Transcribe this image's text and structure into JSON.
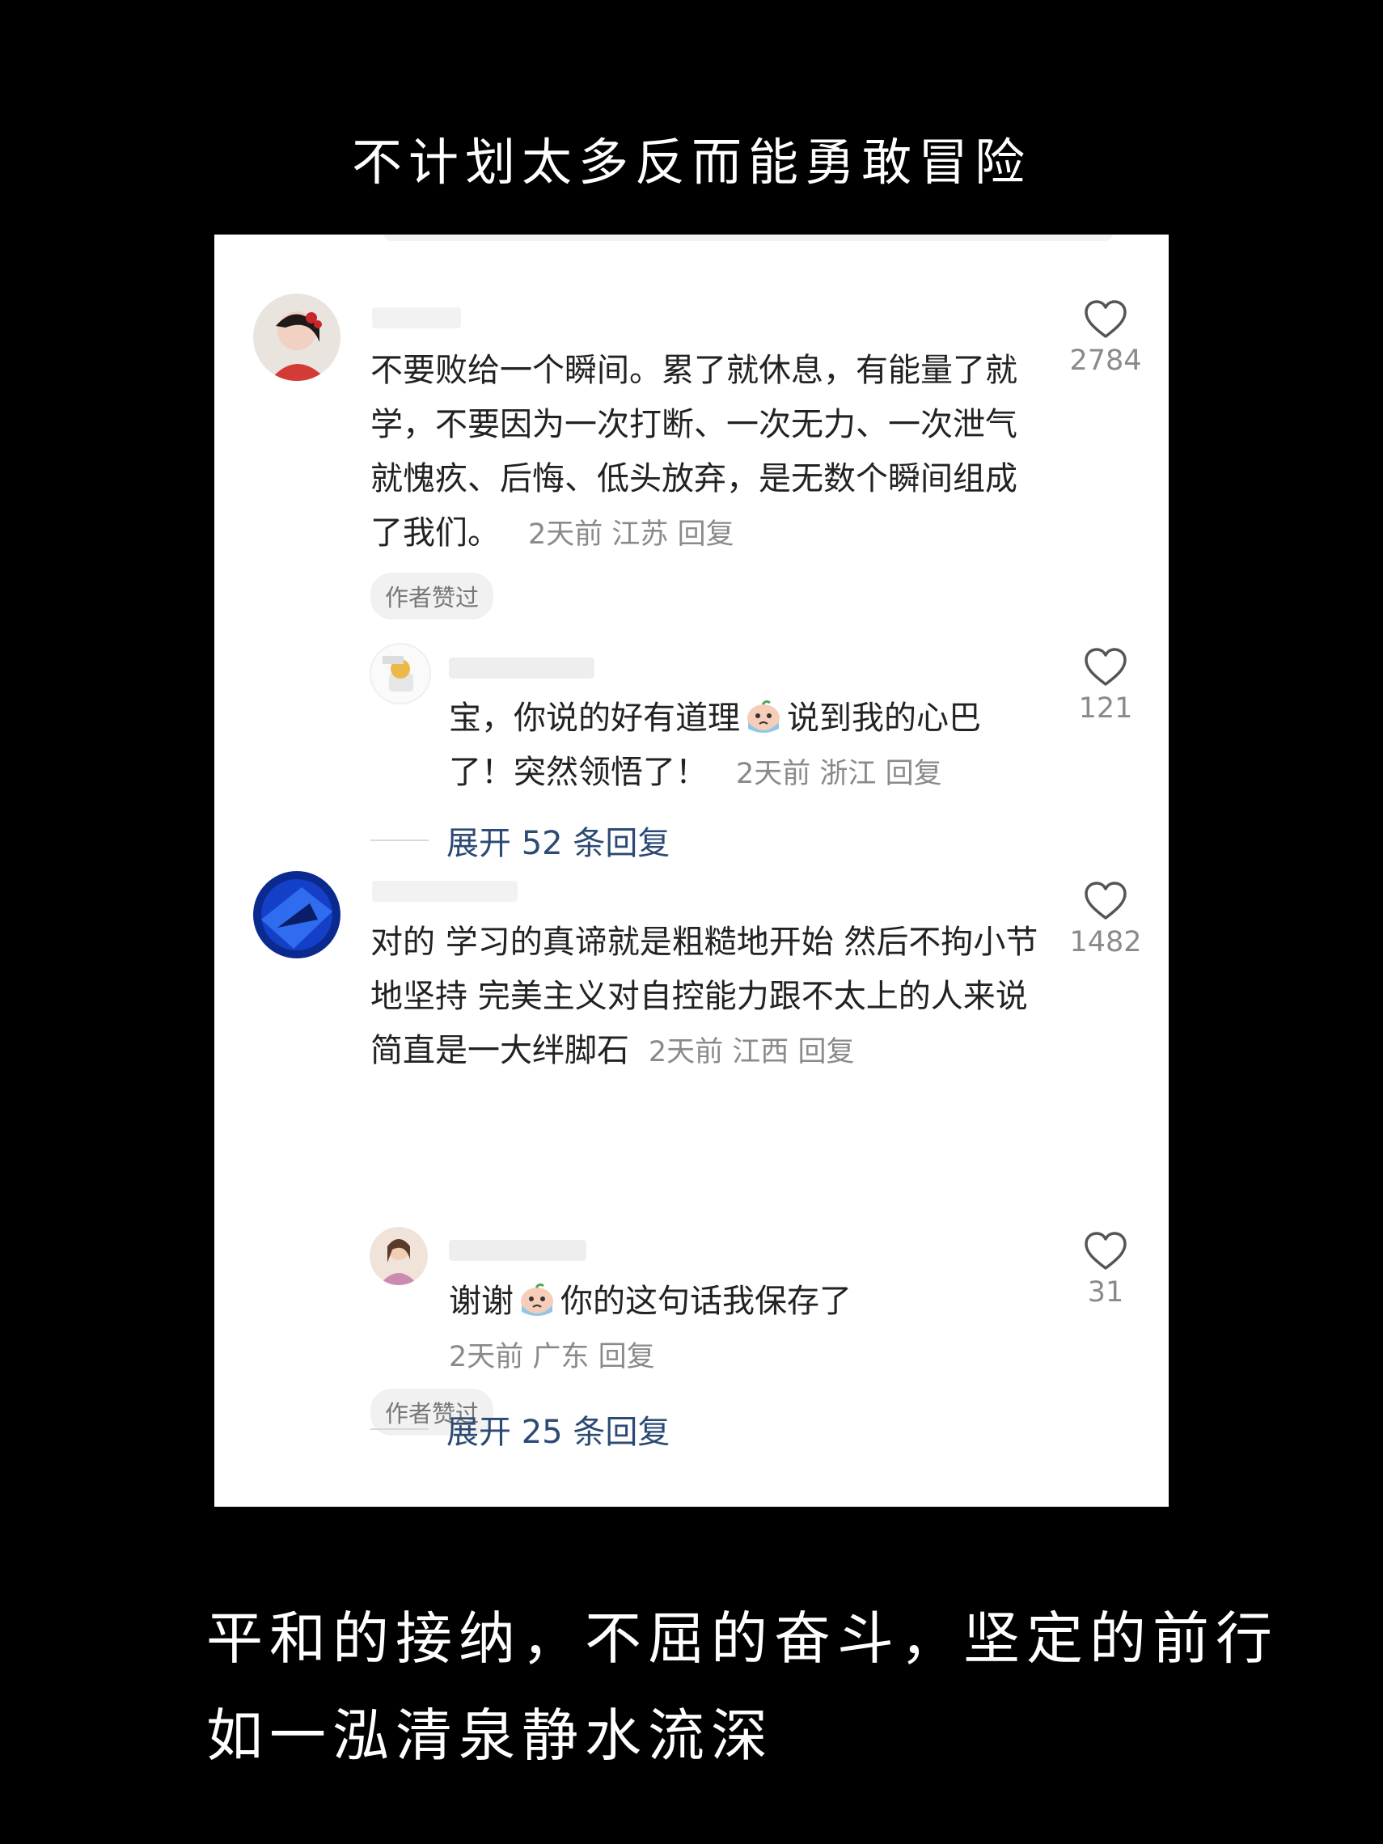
{
  "title": "不计划太多反而能勇敢冒险",
  "comments": [
    {
      "text": "不要败给一个瞬间。累了就休息，有能量了就学，不要因为一次打断、一次无力、一次泄气就愧疚、后悔、低头放弃，是无数个瞬间组成了我们。",
      "time": "2天前",
      "location": "江苏",
      "reply_label": "回复",
      "likes": "2784",
      "author_liked": "作者赞过",
      "reply": {
        "text_before": "宝，你说的好有道理",
        "emoji": "crying-face-emoji",
        "text_after": "说到我的心巴了！突然领悟了！",
        "time": "2天前",
        "location": "浙江",
        "reply_label": "回复",
        "likes": "121"
      },
      "expand_label": "展开 52 条回复"
    },
    {
      "text": "对的 学习的真谛就是粗糙地开始 然后不拘小节地坚持 完美主义对自控能力跟不太上的人来说简直是一大绊脚石",
      "time": "2天前",
      "location": "江西",
      "reply_label": "回复",
      "likes": "1482",
      "author_liked": "作者赞过",
      "reply": {
        "text_before": "谢谢",
        "emoji": "crying-face-emoji",
        "text_after": "你的这句话我保存了",
        "time": "2天前",
        "location": "广东",
        "reply_label": "回复",
        "likes": "31"
      },
      "expand_label": "展开 25 条回复"
    }
  ],
  "caption_line1": "平和的接纳，不屈的奋斗，坚定的前行",
  "caption_line2": "如一泓清泉静水流深",
  "colors": {
    "background": "#000000",
    "panel": "#ffffff",
    "expand_link": "#2c4a74",
    "meta": "#8a8a8a"
  }
}
